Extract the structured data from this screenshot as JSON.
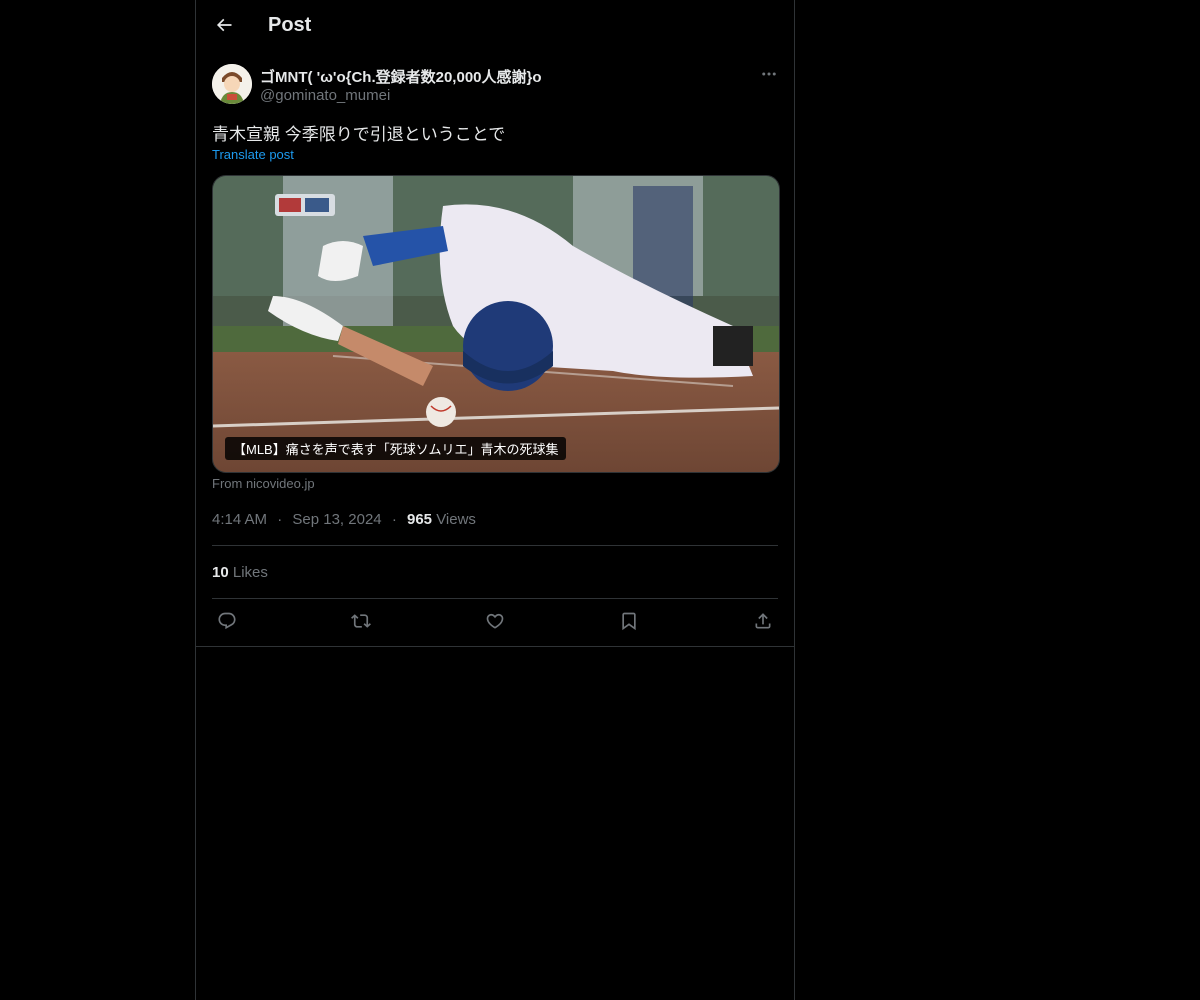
{
  "header": {
    "title": "Post",
    "back_icon": "arrow-left-icon"
  },
  "post": {
    "author": {
      "display_name": "ゴMNT( 'ω'o{Ch.登録者数20,000人感謝}o",
      "handle": "@gominato_mumei",
      "avatar_icon": "avatar"
    },
    "more_icon": "more-horizontal-icon",
    "text": "青木宣親 今季限りで引退ということで",
    "translate_label": "Translate post",
    "media": {
      "caption": "【MLB】痛さを声で表す「死球ソムリエ」青木の死球集",
      "source": "From nicovideo.jp"
    },
    "time": "4:14 AM",
    "date": "Sep 13, 2024",
    "views_count": "965",
    "views_label": "Views",
    "likes_count": "10",
    "likes_label": "Likes"
  },
  "actions": [
    {
      "icon": "reply-icon"
    },
    {
      "icon": "repost-icon"
    },
    {
      "icon": "like-icon"
    },
    {
      "icon": "bookmark-icon"
    },
    {
      "icon": "share-icon"
    }
  ],
  "colors": {
    "background": "#000000",
    "text": "#e7e9ea",
    "secondary": "#71767b",
    "link": "#1d9bf0",
    "border": "#2f3336"
  }
}
